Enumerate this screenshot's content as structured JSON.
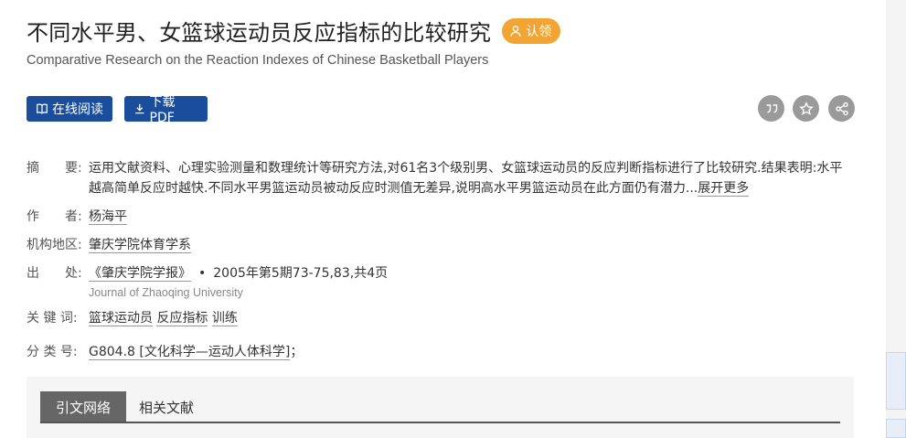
{
  "header": {
    "title": "不同水平男、女篮球运动员反应指标的比较研究",
    "claim_label": "认领",
    "subtitle": "Comparative Research on the Reaction Indexes of Chinese Basketball Players"
  },
  "actions": {
    "read_online": "在线阅读",
    "download_pdf": "下载PDF"
  },
  "fields": {
    "abstract_label": "摘　　要:",
    "abstract_text": "运用文献资料、心理实验测量和数理统计等研究方法,对61名3个级别男、女篮球运动员的反应判断指标进行了比较研究.结果表明:水平越高简单反应时越快.不同水平男篮运动员被动反应时测值无差异,说明高水平男篮运动员在此方面仍有潜力...",
    "abstract_more": "展开更多",
    "author_label": "作　　者:",
    "author": "杨海平",
    "org_label": "机构地区:",
    "org": "肇庆学院体育学系",
    "source_label": "出　　处:",
    "source_journal": "《肇庆学院学报》",
    "source_detail": "2005年第5期73-75,83,共4页",
    "source_en": "Journal of Zhaoqing University",
    "keywords_label": "关 键 词:",
    "keywords": [
      "篮球运动员",
      "反应指标",
      "训练"
    ],
    "classif_label": "分 类 号:",
    "classif_code": "G804.8 [文化科学—运动人体科学]",
    "classif_end": "；"
  },
  "tabs": {
    "active": "引文网络",
    "other": "相关文献"
  },
  "colors": {
    "primary_button": "#1a4d9c",
    "claim_badge": "#f3a533",
    "icon_circle": "#9a9a9a"
  }
}
